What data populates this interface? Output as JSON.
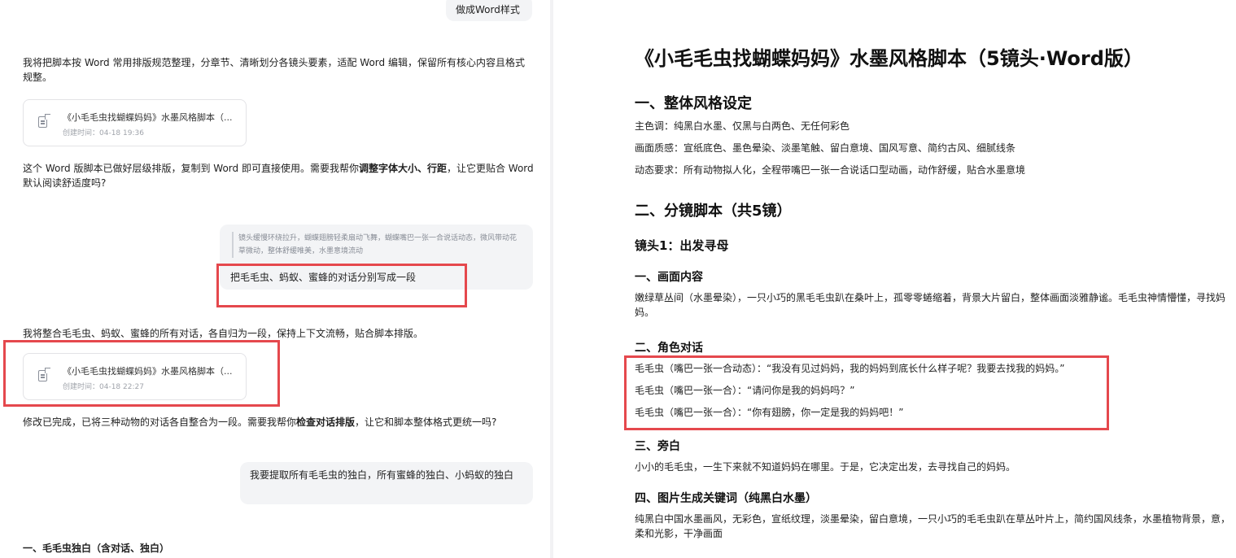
{
  "chat": {
    "top_user_bubble": "做成Word样式",
    "ai_msg_1": "我将把脚本按 Word 常用排版规范整理，分章节、清晰划分各镜头要素，适配 Word 编辑，保留所有核心内容且格式规整。",
    "file_card_1": {
      "title": "《小毛毛虫找蝴蝶妈妈》水墨风格脚本（...",
      "time": "创建时间：04-18 19:36"
    },
    "ai_msg_2": {
      "before": "这个 Word 版脚本已做好层级排版，复制到 Word 即可直接使用。需要我帮你",
      "bold": "调整字体大小、行距",
      "after": "，让它更贴合 Word 默认阅读舒适度吗?"
    },
    "quote_text": "镜头缓慢环绕拉升，蝴蝶翅膀轻柔扇动飞舞，蝴蝶嘴巴一张一合说话动态，微风带动花草微动，整体舒缓唯美，水墨意境流动",
    "user_msg_2": "把毛毛虫、蚂蚁、蜜蜂的对话分别写成一段",
    "ai_msg_3": "我将整合毛毛虫、蚂蚁、蜜蜂的所有对话，各自归为一段，保持上下文流畅，贴合脚本排版。",
    "file_card_2": {
      "title": "《小毛毛虫找蝴蝶妈妈》水墨风格脚本（...",
      "time": "创建时间：04-18 22:27"
    },
    "ai_msg_4": {
      "before": "修改已完成，已将三种动物的对话各自整合为一段。需要我帮你",
      "bold": "检查对话排版",
      "after": "，让它和脚本整体格式更统一吗?"
    },
    "user_msg_3": "我要提取所有毛毛虫的独白，所有蜜蜂的独白、小蚂蚁的独白",
    "ai_msg_5_heading": "一、毛毛虫独白（含对话、独白）"
  },
  "doc": {
    "title": "《小毛毛虫找蝴蝶妈妈》水墨风格脚本（5镜头·Word版）",
    "section1_title": "一、整体风格设定",
    "style_lines": [
      "主色调：纯黑白水墨、仅黑与白两色、无任何彩色",
      "画面质感：宣纸底色、墨色晕染、淡墨笔触、留白意境、国风写意、简约古风、细腻线条",
      "动态要求：所有动物拟人化，全程带嘴巴一张一合说话口型动画，动作舒缓，贴合水墨意境"
    ],
    "section2_title": "二、分镜脚本（共5镜）",
    "shot1_title": "镜头1：出发寻母",
    "sub_content_title": "一、画面内容",
    "content_text": "嫩绿草丛间（水墨晕染），一只小巧的黑毛毛虫趴在桑叶上，孤零零蜷缩着，背景大片留白，整体画面淡雅静谧。毛毛虫神情懵懂，寻找妈妈。",
    "sub_dialogue_title": "二、角色对话",
    "dialogues": [
      "毛毛虫（嘴巴一张一合动态）：“我没有见过妈妈，我的妈妈到底长什么样子呢？我要去找我的妈妈。”",
      "毛毛虫（嘴巴一张一合）：“请问你是我的妈妈吗？”",
      "毛毛虫（嘴巴一张一合）：“你有翅膀，你一定是我的妈妈吧！”"
    ],
    "sub_narration_title": "三、旁白",
    "narration_text": "小小的毛毛虫，一生下来就不知道妈妈在哪里。于是，它决定出发，去寻找自己的妈妈。",
    "sub_keywords_title": "四、图片生成关键词（纯黑白水墨）",
    "keywords_text": "纯黑白中国水墨画风，无彩色，宣纸纹理，淡墨晕染，留白意境，一只小巧的毛毛虫趴在草丛叶片上，简约国风线条，水墨植物背景，意，柔和光影，干净画面"
  },
  "colors": {
    "highlight_box": "#e5484d",
    "user_bubble": "#f3f4f6"
  }
}
